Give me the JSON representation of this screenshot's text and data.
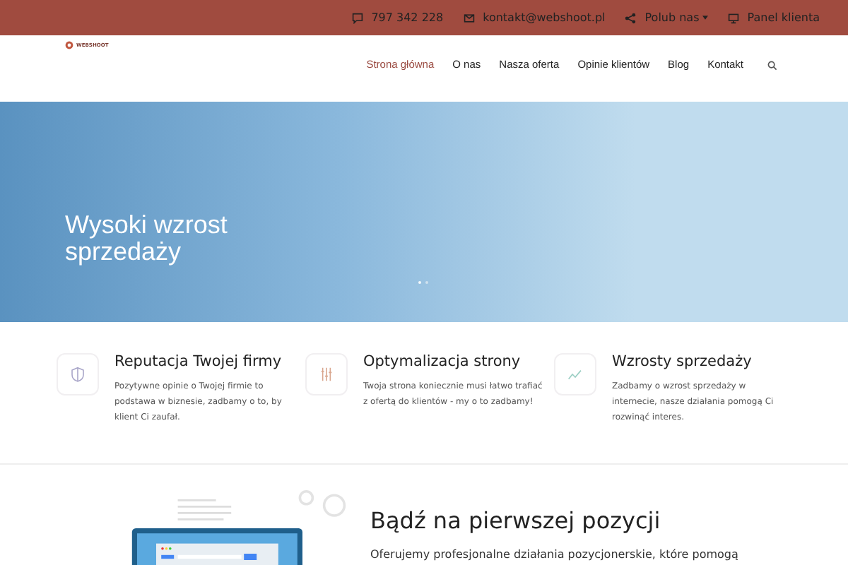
{
  "top_bar": {
    "phone": "797 342 228",
    "email": "kontakt@webshoot.pl",
    "social": "Polub nas",
    "panel": "Panel klienta"
  },
  "logo": {
    "text": "WEBSHOOT"
  },
  "nav": [
    {
      "label": "Strona główna",
      "selected": true
    },
    {
      "label": "O nas",
      "selected": false
    },
    {
      "label": "Nasza oferta",
      "selected": false
    },
    {
      "label": "Opinie klientów",
      "selected": false
    },
    {
      "label": "Blog",
      "selected": false
    },
    {
      "label": "Kontakt",
      "selected": false
    }
  ],
  "hero": {
    "heading": "Wysoki wzrost sprzedaży",
    "dots": [
      {
        "selected": true
      },
      {
        "selected": false
      }
    ]
  },
  "features": [
    {
      "kind": "shield",
      "title": "Reputacja Twojej firmy",
      "text": "Pozytywne opinie o Twojej firmie to podstawa w biznesie, zadbamy o to, by klient Ci zaufał."
    },
    {
      "kind": "sliders",
      "title": "Optymalizacja strony",
      "text": "Twoja strona koniecznie musi łatwo trafiać z ofertą do klientów - my o to zadbamy!"
    },
    {
      "kind": "chart",
      "title": "Wzrosty sprzedaży",
      "text": "Zadbamy o wzrost sprzedaży w internecie, nasze działania pomogą Ci rozwinąć interes."
    }
  ],
  "section": {
    "heading": "Bądź na pierwszej pozycji",
    "text": "Oferujemy profesjonalne działania pozycjonerskie, które pomogą"
  }
}
